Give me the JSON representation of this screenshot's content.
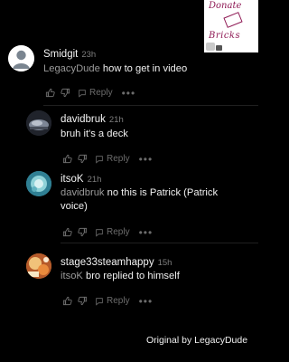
{
  "donate_sticker": {
    "line1": "Donate",
    "line2": "Bricks",
    "color": "#8f1a55"
  },
  "comments": [
    {
      "username": "Smidgit",
      "age": "23h",
      "mention": "LegacyDude",
      "text": " how to get in video",
      "reply_label": "Reply",
      "more": "•••"
    },
    {
      "username": "davidbruk",
      "age": "21h",
      "mention": "",
      "text": "bruh it's a deck",
      "reply_label": "Reply",
      "more": "•••"
    },
    {
      "username": "itsoK",
      "age": "21h",
      "mention": "davidbruk",
      "text_line1": " no this is Patrick (Patrick",
      "text_line2": "voice)",
      "reply_label": "Reply",
      "more": "•••"
    },
    {
      "username": "stage33steamhappy",
      "age": "15h",
      "mention": "itsoK",
      "text": " bro replied to himself",
      "reply_label": "Reply",
      "more": "•••"
    }
  ],
  "credit": "Original by LegacyDude",
  "colors": {
    "background": "#000000",
    "username": "#f4f4f4",
    "muted": "#7e7e7e",
    "mention": "#9a9a9a"
  },
  "icons": [
    "like-icon",
    "dislike-icon",
    "reply-icon",
    "more-icon"
  ]
}
